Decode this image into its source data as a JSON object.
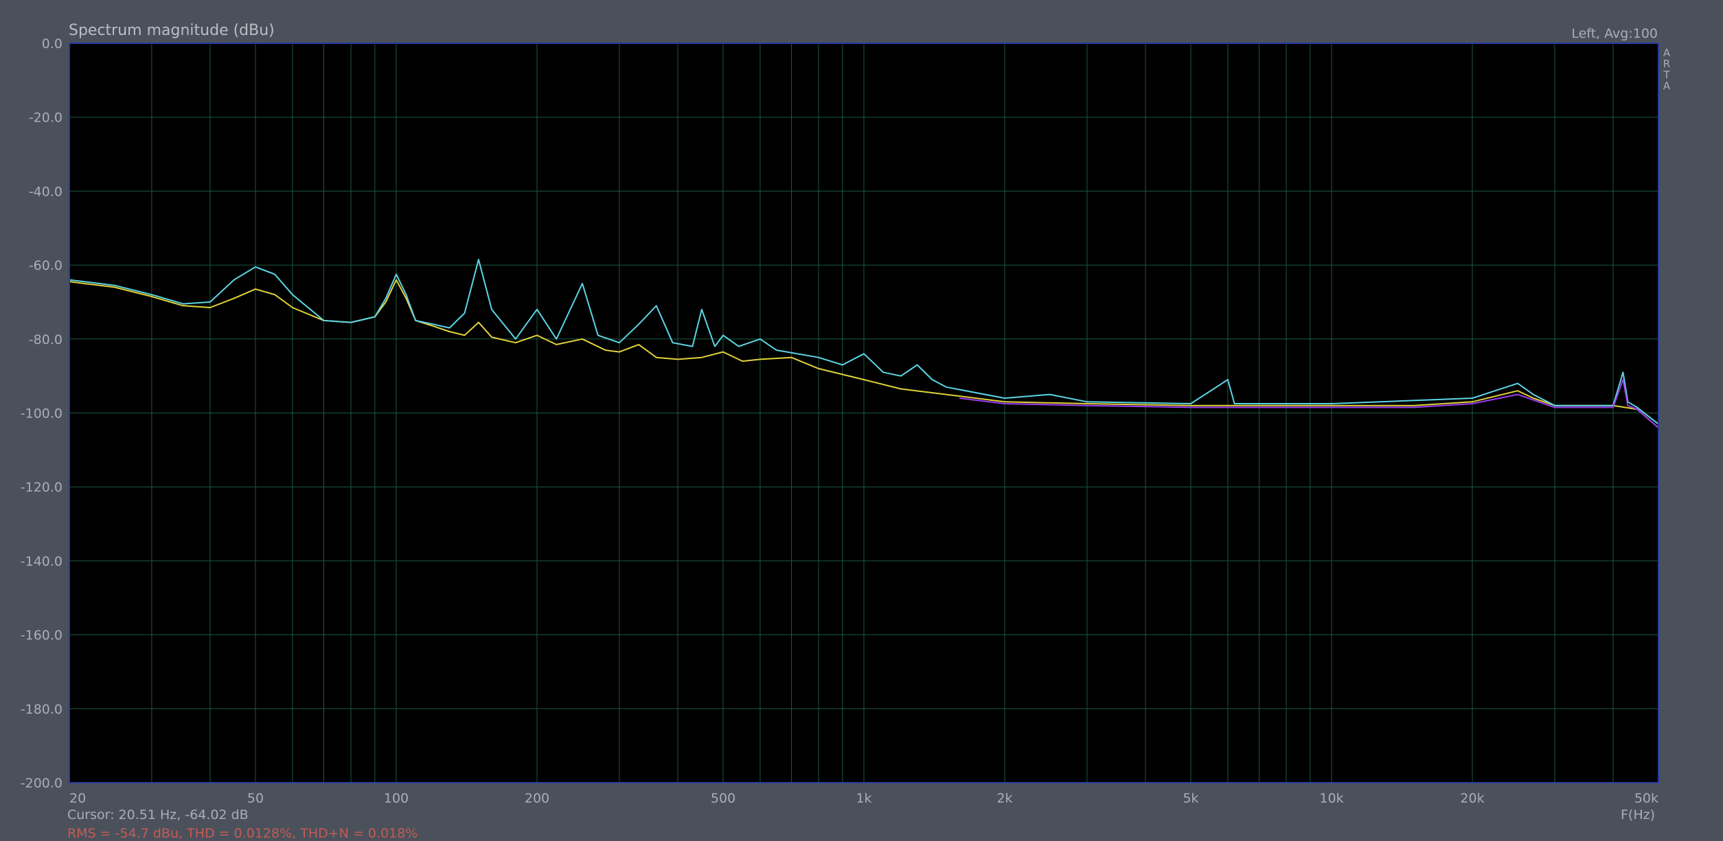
{
  "window": {
    "title": "Spectrum magnitude (dBu)",
    "channel_label": "Left, Avg:100",
    "side_label": "ARTA"
  },
  "status": {
    "cursor_text": "Cursor: 20.51 Hz, -64.02 dB",
    "rms_text": "RMS = -54.7 dBu, THD = 0.0128%, THD+N = 0.018%"
  },
  "colors": {
    "background": "#4a515b",
    "plot_bg": "#000000",
    "grid": "#1a5a3e",
    "frame": "#2a3aa0",
    "series_cyan": "#5cd6e6",
    "series_yellow": "#e3d23a",
    "series_purple": "#9b3df0",
    "rms_text": "#c65a55",
    "thd_text": "#4fc0c8"
  },
  "chart_data": {
    "type": "line",
    "title": "Spectrum magnitude (dBu)",
    "xlabel": "F(Hz)",
    "ylabel": "",
    "xscale": "log",
    "xlim": [
      20,
      50000
    ],
    "ylim": [
      -200,
      0
    ],
    "grid": true,
    "x_ticks": [
      {
        "v": 20,
        "label": "20"
      },
      {
        "v": 50,
        "label": "50"
      },
      {
        "v": 100,
        "label": "100"
      },
      {
        "v": 200,
        "label": "200"
      },
      {
        "v": 500,
        "label": "500"
      },
      {
        "v": 1000,
        "label": "1k"
      },
      {
        "v": 2000,
        "label": "2k"
      },
      {
        "v": 5000,
        "label": "5k"
      },
      {
        "v": 10000,
        "label": "10k"
      },
      {
        "v": 20000,
        "label": "20k"
      },
      {
        "v": 50000,
        "label": "50k"
      }
    ],
    "y_ticks": [
      {
        "v": 0,
        "label": "0.0"
      },
      {
        "v": -20,
        "label": "-20.0"
      },
      {
        "v": -40,
        "label": "-40.0"
      },
      {
        "v": -60,
        "label": "-60.0"
      },
      {
        "v": -80,
        "label": "-80.0"
      },
      {
        "v": -100,
        "label": "-100.0"
      },
      {
        "v": -120,
        "label": "-120.0"
      },
      {
        "v": -140,
        "label": "-140.0"
      },
      {
        "v": -160,
        "label": "-160.0"
      },
      {
        "v": -180,
        "label": "-180.0"
      },
      {
        "v": -200,
        "label": "-200.0"
      }
    ],
    "series": [
      {
        "color": "#e3d23a",
        "points": [
          [
            20,
            -64.5
          ],
          [
            25,
            -66
          ],
          [
            30,
            -68.5
          ],
          [
            35,
            -71
          ],
          [
            40,
            -71.5
          ],
          [
            45,
            -69
          ],
          [
            50,
            -66.5
          ],
          [
            55,
            -68
          ],
          [
            60,
            -71.5
          ],
          [
            70,
            -75
          ],
          [
            80,
            -75.5
          ],
          [
            90,
            -74
          ],
          [
            95,
            -70
          ],
          [
            100,
            -64
          ],
          [
            105,
            -69
          ],
          [
            110,
            -75
          ],
          [
            120,
            -76.5
          ],
          [
            130,
            -78
          ],
          [
            140,
            -79
          ],
          [
            150,
            -75.5
          ],
          [
            160,
            -79.5
          ],
          [
            180,
            -81
          ],
          [
            200,
            -79
          ],
          [
            220,
            -81.5
          ],
          [
            250,
            -80
          ],
          [
            280,
            -83
          ],
          [
            300,
            -83.5
          ],
          [
            330,
            -81.5
          ],
          [
            360,
            -85
          ],
          [
            400,
            -85.5
          ],
          [
            450,
            -85
          ],
          [
            500,
            -83.5
          ],
          [
            550,
            -86
          ],
          [
            600,
            -85.5
          ],
          [
            700,
            -85
          ],
          [
            800,
            -88
          ],
          [
            1000,
            -91
          ],
          [
            1200,
            -93.5
          ],
          [
            1500,
            -95
          ],
          [
            2000,
            -97
          ],
          [
            3000,
            -97.5
          ],
          [
            5000,
            -98
          ],
          [
            10000,
            -98
          ],
          [
            15000,
            -98
          ],
          [
            20000,
            -97
          ],
          [
            25000,
            -94
          ],
          [
            27000,
            -96
          ],
          [
            30000,
            -98
          ],
          [
            40000,
            -98
          ],
          [
            45000,
            -99
          ],
          [
            50000,
            -104
          ]
        ]
      },
      {
        "color": "#5cd6e6",
        "points": [
          [
            20,
            -64
          ],
          [
            25,
            -65.5
          ],
          [
            30,
            -68
          ],
          [
            35,
            -70.5
          ],
          [
            40,
            -70
          ],
          [
            45,
            -64
          ],
          [
            50,
            -60.5
          ],
          [
            55,
            -62.5
          ],
          [
            60,
            -68
          ],
          [
            70,
            -75
          ],
          [
            80,
            -75.5
          ],
          [
            90,
            -74
          ],
          [
            95,
            -69
          ],
          [
            100,
            -62.5
          ],
          [
            105,
            -68
          ],
          [
            110,
            -75
          ],
          [
            120,
            -76
          ],
          [
            130,
            -77
          ],
          [
            140,
            -73
          ],
          [
            150,
            -58.5
          ],
          [
            160,
            -72
          ],
          [
            180,
            -80
          ],
          [
            200,
            -72
          ],
          [
            220,
            -80
          ],
          [
            250,
            -65
          ],
          [
            270,
            -79
          ],
          [
            300,
            -81
          ],
          [
            330,
            -76
          ],
          [
            360,
            -71
          ],
          [
            390,
            -81
          ],
          [
            430,
            -82
          ],
          [
            450,
            -72
          ],
          [
            480,
            -82
          ],
          [
            500,
            -79
          ],
          [
            540,
            -82
          ],
          [
            600,
            -80
          ],
          [
            650,
            -83
          ],
          [
            800,
            -85
          ],
          [
            900,
            -87
          ],
          [
            1000,
            -84
          ],
          [
            1100,
            -89
          ],
          [
            1200,
            -90
          ],
          [
            1300,
            -87
          ],
          [
            1400,
            -91
          ],
          [
            1500,
            -93
          ],
          [
            2000,
            -96
          ],
          [
            2500,
            -95
          ],
          [
            3000,
            -97
          ],
          [
            5000,
            -97.5
          ],
          [
            6000,
            -91
          ],
          [
            6200,
            -97.5
          ],
          [
            10000,
            -97.5
          ],
          [
            20000,
            -96
          ],
          [
            25000,
            -92
          ],
          [
            27000,
            -95
          ],
          [
            30000,
            -98
          ],
          [
            40000,
            -98
          ],
          [
            42000,
            -89
          ],
          [
            43000,
            -97
          ],
          [
            45000,
            -98.5
          ],
          [
            50000,
            -103
          ]
        ]
      },
      {
        "color": "#9b3df0",
        "points": [
          [
            1600,
            -96
          ],
          [
            2000,
            -97.5
          ],
          [
            3000,
            -98
          ],
          [
            5000,
            -98.5
          ],
          [
            10000,
            -98.5
          ],
          [
            15000,
            -98.5
          ],
          [
            20000,
            -97.5
          ],
          [
            25000,
            -95
          ],
          [
            27000,
            -96.5
          ],
          [
            30000,
            -98.5
          ],
          [
            40000,
            -98.5
          ],
          [
            42000,
            -91
          ],
          [
            43000,
            -98
          ],
          [
            45000,
            -99
          ],
          [
            50000,
            -104
          ]
        ]
      }
    ]
  }
}
